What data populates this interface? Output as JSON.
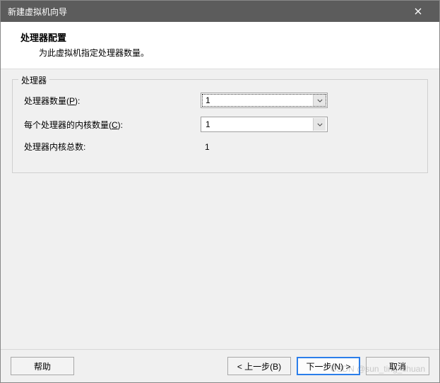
{
  "titlebar": {
    "title": "新建虚拟机向导"
  },
  "header": {
    "title": "处理器配置",
    "subtitle": "为此虚拟机指定处理器数量。"
  },
  "group": {
    "label": "处理器",
    "rows": {
      "count": {
        "label_pre": "处理器数量(",
        "hotkey": "P",
        "label_post": "):",
        "value": "1"
      },
      "cores": {
        "label_pre": "每个处理器的内核数量(",
        "hotkey": "C",
        "label_post": "):",
        "value": "1"
      },
      "total": {
        "label": "处理器内核总数:",
        "value": "1"
      }
    }
  },
  "footer": {
    "help": "帮助",
    "back": "< 上一步(B)",
    "next": "下一步(N) >",
    "cancel": "取消"
  },
  "watermark": "CSDN @sun_ting_chuan"
}
